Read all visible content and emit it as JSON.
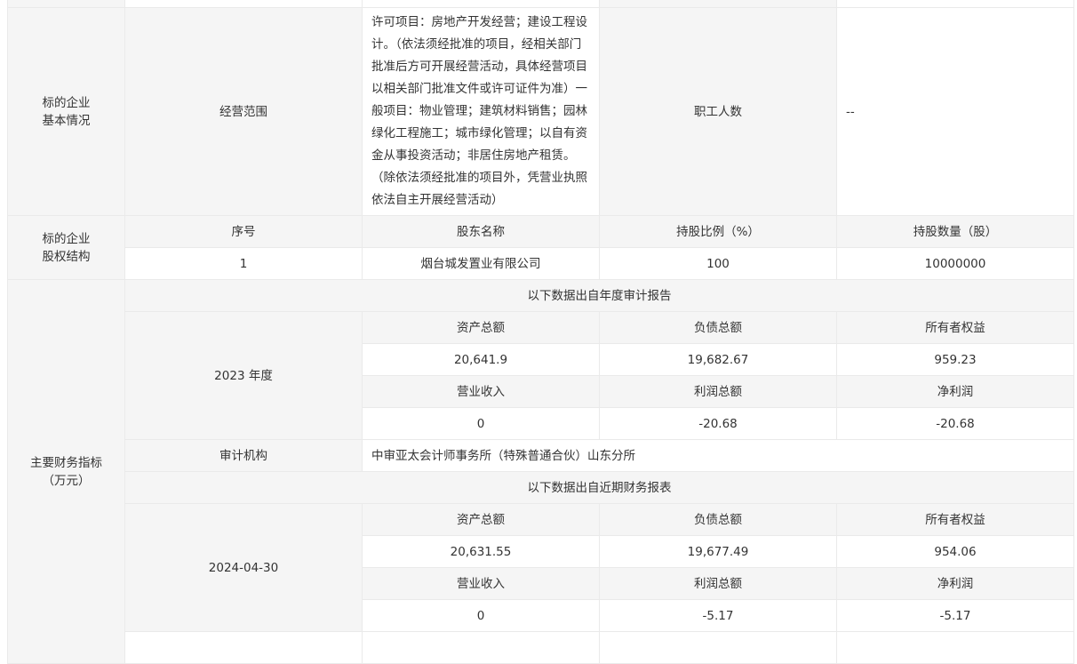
{
  "basic": {
    "section_label": [
      "标的企业",
      "基本情况"
    ],
    "scope_label": "经营范围",
    "scope_text": "许可项目：房地产开发经营；建设工程设计。（依法须经批准的项目，经相关部门批准后方可开展经营活动，具体经营项目以相关部门批准文件或许可证件为准）一般项目：物业管理；建筑材料销售；园林绿化工程施工；城市绿化管理；以自有资金从事投资活动；非居住房地产租赁。（除依法须经批准的项目外，凭营业执照依法自主开展经营活动）",
    "staff_label": "职工人数",
    "staff_value": "--"
  },
  "equity": {
    "section_label": [
      "标的企业",
      "股权结构"
    ],
    "headers": [
      "序号",
      "股东名称",
      "持股比例（%）",
      "持股数量（股）"
    ],
    "rows": [
      [
        "1",
        "烟台城发置业有限公司",
        "100",
        "10000000"
      ]
    ]
  },
  "finance": {
    "section_label": [
      "主要财务指标",
      "（万元）"
    ],
    "annual_caption": "以下数据出自年度审计报告",
    "annual_period": "2023 年度",
    "headers1": [
      "资产总额",
      "负债总额",
      "所有者权益"
    ],
    "annual_values1": [
      "20,641.9",
      "19,682.67",
      "959.23"
    ],
    "headers2": [
      "营业收入",
      "利润总额",
      "净利润"
    ],
    "annual_values2": [
      "0",
      "-20.68",
      "-20.68"
    ],
    "audit_label": "审计机构",
    "audit_value": "中审亚太会计师事务所（特殊普通合伙）山东分所",
    "recent_caption": "以下数据出自近期财务报表",
    "recent_period": "2024-04-30",
    "recent_values1": [
      "20,631.55",
      "19,677.49",
      "954.06"
    ],
    "recent_values2": [
      "0",
      "-5.17",
      "-5.17"
    ]
  }
}
